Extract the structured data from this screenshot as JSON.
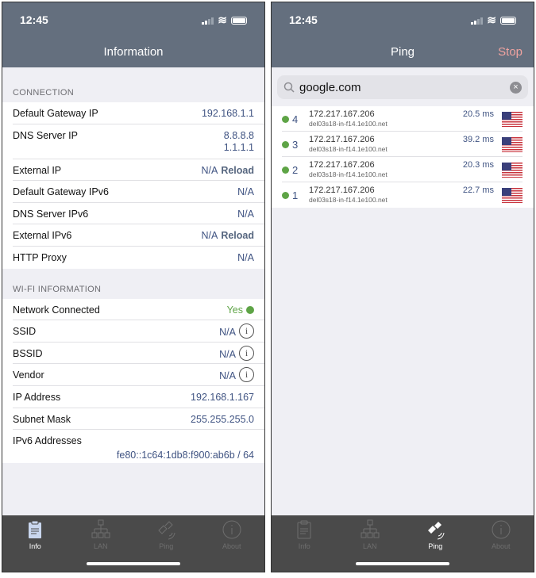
{
  "left": {
    "status": {
      "time": "12:45"
    },
    "title": "Information",
    "connection": {
      "header": "CONNECTION",
      "rows": [
        {
          "label": "Default Gateway IP",
          "value": "192.168.1.1"
        },
        {
          "label": "DNS Server IP",
          "values": [
            "8.8.8.8",
            "1.1.1.1"
          ]
        },
        {
          "label": "External IP",
          "value": "N/A",
          "action": "Reload"
        },
        {
          "label": "Default Gateway IPv6",
          "value": "N/A"
        },
        {
          "label": "DNS Server IPv6",
          "value": "N/A"
        },
        {
          "label": "External IPv6",
          "value": "N/A",
          "action": "Reload"
        },
        {
          "label": "HTTP Proxy",
          "value": "N/A"
        }
      ]
    },
    "wifi": {
      "header": "WI-FI INFORMATION",
      "rows": [
        {
          "label": "Network Connected",
          "value": "Yes"
        },
        {
          "label": "SSID",
          "value": "N/A"
        },
        {
          "label": "BSSID",
          "value": "N/A"
        },
        {
          "label": "Vendor",
          "value": "N/A"
        },
        {
          "label": "IP Address",
          "value": "192.168.1.167"
        },
        {
          "label": "Subnet Mask",
          "value": "255.255.255.0"
        },
        {
          "label": "IPv6 Addresses",
          "value": "fe80::1c64:1db8:f900:ab6b / 64"
        }
      ]
    },
    "active_tab": "Info"
  },
  "right": {
    "status": {
      "time": "12:45"
    },
    "title": "Ping",
    "stop_label": "Stop",
    "search": {
      "value": "google.com"
    },
    "results": [
      {
        "seq": "4",
        "ip": "172.217.167.206",
        "host": "del03s18-in-f14.1e100.net",
        "time": "20.5 ms",
        "flag": "us-flag"
      },
      {
        "seq": "3",
        "ip": "172.217.167.206",
        "host": "del03s18-in-f14.1e100.net",
        "time": "39.2 ms",
        "flag": "us-flag"
      },
      {
        "seq": "2",
        "ip": "172.217.167.206",
        "host": "del03s18-in-f14.1e100.net",
        "time": "20.3 ms",
        "flag": "us-flag"
      },
      {
        "seq": "1",
        "ip": "172.217.167.206",
        "host": "del03s18-in-f14.1e100.net",
        "time": "22.7 ms",
        "flag": "us-flag"
      }
    ],
    "active_tab": "Ping"
  },
  "tabs": [
    {
      "label": "Info",
      "icon": "clipboard-icon"
    },
    {
      "label": "LAN",
      "icon": "network-icon"
    },
    {
      "label": "Ping",
      "icon": "satellite-icon"
    },
    {
      "label": "About",
      "icon": "info-icon"
    }
  ],
  "colors": {
    "header": "#646f7e",
    "value": "#3f5382",
    "status_ok": "#5ea446",
    "stop": "#f0a3a0",
    "tabbar": "#4a4a4a"
  }
}
